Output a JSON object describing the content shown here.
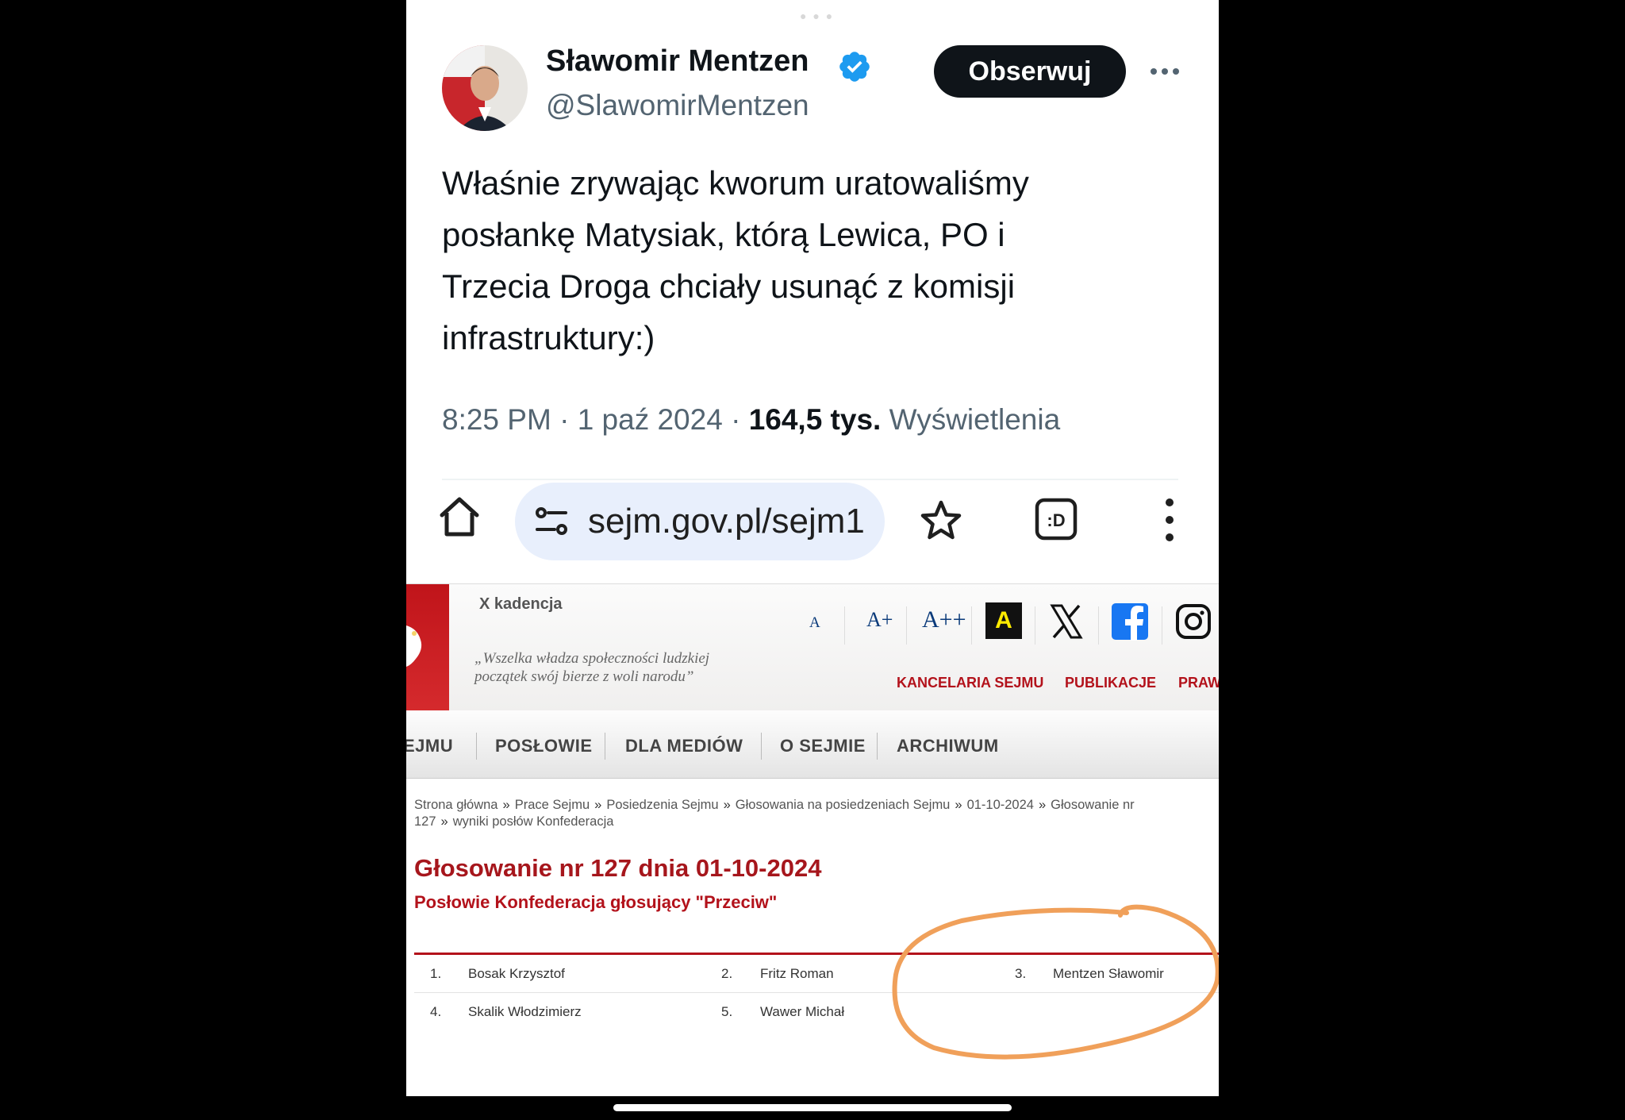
{
  "tweet": {
    "author_name": "Sławomir Mentzen",
    "handle": "@SlawomirMentzen",
    "follow_label": "Obserwuj",
    "text": "Właśnie zrywając kworum uratowaliśmy\nposłankę Matysiak, którą Lewica, PO i\nTrzecia Droga chciały usunąć z komisji\ninfrastruktury:)",
    "time": "8:25 PM",
    "date": "1 paź 2024",
    "views_count": "164,5 tys.",
    "views_label": "Wyświetlenia"
  },
  "browser": {
    "url": "sejm.gov.pl/sejm1"
  },
  "sejm": {
    "kadencja": "X kadencja",
    "motto": "„Wszelka władza społeczności ludzkiej\npoczątek swój bierze z woli narodu”",
    "font_sizes": [
      "A",
      "A+",
      "A++"
    ],
    "contrast_label": "A",
    "top_links": [
      "KANCELARIA SEJMU",
      "PUBLIKACJE",
      "PRAW"
    ],
    "nav": [
      "EJMU",
      "POSŁOWIE",
      "DLA MEDIÓW",
      "O SEJMIE",
      "ARCHIWUM"
    ],
    "breadcrumb": [
      "Strona główna",
      "Prace Sejmu",
      "Posiedzenia Sejmu",
      "Głosowania na posiedzeniach Sejmu",
      "01-10-2024",
      "Głosowanie nr 127",
      "wyniki posłów Konfederacja"
    ],
    "title": "Głosowanie nr 127 dnia 01-10-2024",
    "subtitle": "Posłowie Konfederacja głosujący \"Przeciw\"",
    "members": [
      {
        "no": "1.",
        "name": "Bosak Krzysztof"
      },
      {
        "no": "2.",
        "name": "Fritz Roman"
      },
      {
        "no": "3.",
        "name": "Mentzen Sławomir"
      },
      {
        "no": "4.",
        "name": "Skalik Włodzimierz"
      },
      {
        "no": "5.",
        "name": "Wawer Michał"
      }
    ],
    "highlight_color": "#f0a05a",
    "accent_color": "#b3121b"
  }
}
